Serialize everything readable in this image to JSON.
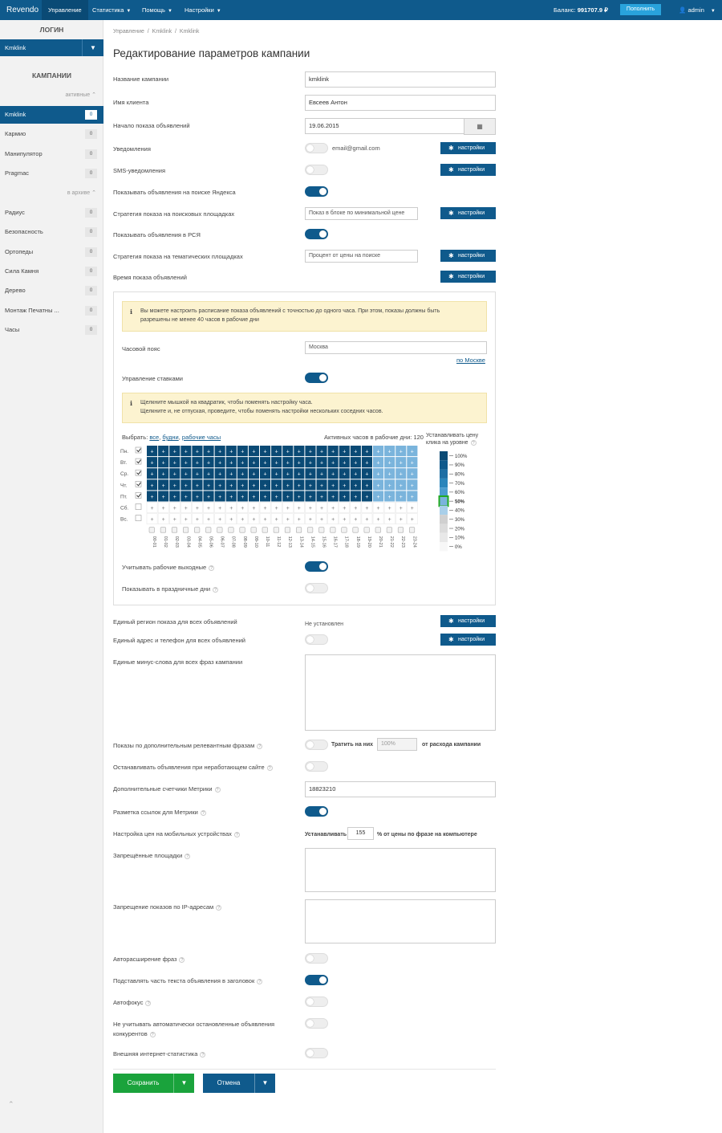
{
  "topbar": {
    "brand": "Revendo",
    "nav": [
      "Управление",
      "Статистика",
      "Помощь",
      "Настройки"
    ],
    "balance_label": "Баланс:",
    "balance_value": "991707.9 ₽",
    "topup": "Пополнить",
    "user": "admin"
  },
  "sidebar": {
    "login_title": "ЛОГИН",
    "login_value": "Kmklink",
    "campaigns_title": "КАМПАНИИ",
    "active_label": "активные",
    "archive_label": "в архиве",
    "active": [
      {
        "name": "Kmklink",
        "count": "0"
      },
      {
        "name": "Кармио",
        "count": "0"
      },
      {
        "name": "Манипулятор",
        "count": "0"
      },
      {
        "name": "Pragmac",
        "count": "0"
      }
    ],
    "archive": [
      {
        "name": "Радиус",
        "count": "0"
      },
      {
        "name": "Безопасность",
        "count": "0"
      },
      {
        "name": "Ортопеды",
        "count": "0"
      },
      {
        "name": "Сила Камня",
        "count": "0"
      },
      {
        "name": "Дерево",
        "count": "0"
      },
      {
        "name": "Монтаж Печатны ...",
        "count": "0"
      },
      {
        "name": "Часы",
        "count": "0"
      }
    ]
  },
  "breadcrumbs": [
    "Управление",
    "Kmklink",
    "Kmklink"
  ],
  "page_title": "Редактирование параметров кампании",
  "settings_btn": "настройки",
  "form": {
    "campaign_name_label": "Название кампании",
    "campaign_name": "kmklink",
    "client_name_label": "Имя клиента",
    "client_name": "Евсеев Антон",
    "start_label": "Начало показа объявлений",
    "start_date": "19.06.2015",
    "notify_label": "Уведомления",
    "notify_email": "email@gmail.com",
    "sms_label": "SMS-уведомления",
    "search_show_label": "Показывать объявления на поиске Яндекса",
    "search_strategy_label": "Стратегия показа на поисковых площадках",
    "search_strategy": "Показ в блоке по минимальной цене",
    "rsya_label": "Показывать объявления в РСЯ",
    "thematic_strategy_label": "Стратегия показа на тематических площадках",
    "thematic_strategy": "Процент от цены на поиске",
    "time_label": "Время показа объявлений"
  },
  "schedule": {
    "notice1a": "Вы можете настроить расписание показа объявлений с точностью до одного часа. При этом, показы должны быть",
    "notice1b": "разрешены не менее 40 часов в рабочие дни",
    "tz_label": "Часовой пояс",
    "tz_value": "Москва",
    "tz_link": "по Москве",
    "bids_label": "Управление ставками",
    "notice2a": "Щелкните мышкой на квадратик, чтобы поменять настройку часа.",
    "notice2b": "Щелкните и, не отпуская, проведите, чтобы поменять настройки нескольких соседних часов.",
    "select_label": "Выбрать:",
    "select_all": "все",
    "select_weekdays": "будни",
    "select_workhours": "рабочие часы",
    "active_hours_label": "Активных часов в рабочие дни:",
    "active_hours": "120",
    "price_label_1": "Устанавливать цену",
    "price_label_2": "клика на уровне",
    "workdays_label": "Учитывать рабочие выходные",
    "holidays_label": "Показывать в праздничные дни"
  },
  "chart_data": {
    "type": "heatmap",
    "y": [
      "Пн.",
      "Вт.",
      "Ср.",
      "Чт.",
      "Пт.",
      "Сб.",
      "Вс."
    ],
    "x": [
      "00-01",
      "01-02",
      "02-03",
      "03-04",
      "04-05",
      "05-06",
      "06-07",
      "07-08",
      "08-09",
      "09-10",
      "10-11",
      "11-12",
      "12-13",
      "13-14",
      "14-15",
      "15-16",
      "16-17",
      "17-18",
      "18-19",
      "19-20",
      "20-21",
      "21-22",
      "22-23",
      "23-24"
    ],
    "day_checked": [
      true,
      true,
      true,
      true,
      true,
      false,
      false
    ],
    "values": [
      [
        100,
        100,
        100,
        100,
        100,
        100,
        100,
        100,
        100,
        100,
        100,
        100,
        100,
        100,
        100,
        100,
        100,
        100,
        100,
        100,
        50,
        50,
        50,
        50
      ],
      [
        100,
        100,
        100,
        100,
        100,
        100,
        100,
        100,
        100,
        100,
        100,
        100,
        100,
        100,
        100,
        100,
        100,
        100,
        100,
        100,
        50,
        50,
        50,
        50
      ],
      [
        100,
        100,
        100,
        100,
        100,
        100,
        100,
        100,
        100,
        100,
        100,
        100,
        100,
        100,
        100,
        100,
        100,
        100,
        100,
        100,
        50,
        50,
        50,
        50
      ],
      [
        100,
        100,
        100,
        100,
        100,
        100,
        100,
        100,
        100,
        100,
        100,
        100,
        100,
        100,
        100,
        100,
        100,
        100,
        100,
        100,
        50,
        50,
        50,
        50
      ],
      [
        100,
        100,
        100,
        100,
        100,
        100,
        100,
        100,
        100,
        100,
        100,
        100,
        100,
        100,
        100,
        100,
        100,
        100,
        100,
        100,
        50,
        50,
        50,
        50
      ],
      [
        0,
        0,
        0,
        0,
        0,
        0,
        0,
        0,
        0,
        0,
        0,
        0,
        0,
        0,
        0,
        0,
        0,
        0,
        0,
        0,
        0,
        0,
        0,
        0
      ],
      [
        0,
        0,
        0,
        0,
        0,
        0,
        0,
        0,
        0,
        0,
        0,
        0,
        0,
        0,
        0,
        0,
        0,
        0,
        0,
        0,
        0,
        0,
        0,
        0
      ]
    ],
    "cell_mark": "+",
    "levels": [
      "100%",
      "90%",
      "80%",
      "70%",
      "60%",
      "50%",
      "40%",
      "30%",
      "20%",
      "10%",
      "0%"
    ],
    "level_colors": [
      "#0a4a75",
      "#0f5a8c",
      "#1d6ea4",
      "#2a85bb",
      "#4a9ccf",
      "#7ab4dc",
      "#a9cfe9",
      "#d0d0d0",
      "#dcdcdc",
      "#e8e8e8",
      "#f7f7f7"
    ],
    "selected_level": "50%",
    "legend": "right"
  },
  "form2": {
    "region_label": "Единый регион показа для всех объявлений",
    "region_value": "Не установлен",
    "address_label": "Единый адрес и телефон для всех объявлений",
    "minus_label": "Единые минус-слова для всех фраз кампании",
    "extra_label": "Показы по дополнительным релевантным фразам",
    "extra_spend": "Тратить на них",
    "extra_placeholder": "100%",
    "extra_suffix": "от расхода кампании",
    "stop_label": "Останавливать объявления при неработающем сайте",
    "metrika_label": "Дополнительные счетчики Метрики",
    "metrika_value": "18823210",
    "markup_label": "Разметка ссылок для Метрики",
    "mobile_label": "Настройка цен на мобильных устройствах",
    "mobile_set": "Устанавливать",
    "mobile_value": "155",
    "mobile_suffix": "% от цены по фразе на компьютере",
    "forbidden_label": "Запрещённые площадки",
    "ip_label": "Запрещение показов по IP-адресам",
    "autoexpand_label": "Авторасширение фраз",
    "substitute_label": "Подставлять часть текста объявления в заголовок",
    "autofocus_label": "Автофокус",
    "ignore_label_1": "Не учитывать автоматически остановленные объявления",
    "ignore_label_2": "конкурентов",
    "stats_label": "Внешняя интернет-статистика"
  },
  "actions": {
    "save": "Сохранить",
    "cancel": "Отмена"
  },
  "colors": {
    "primary": "#0f5a8c",
    "accent": "#29a3dc",
    "save": "#1aa33c"
  }
}
